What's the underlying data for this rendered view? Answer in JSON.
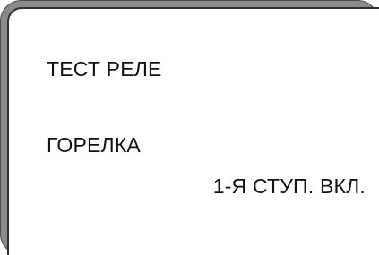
{
  "display": {
    "title": "ТЕСТ РЕЛЕ",
    "item_label": "ГОРЕЛКА",
    "item_value": "1-Я СТУП. ВКЛ."
  }
}
